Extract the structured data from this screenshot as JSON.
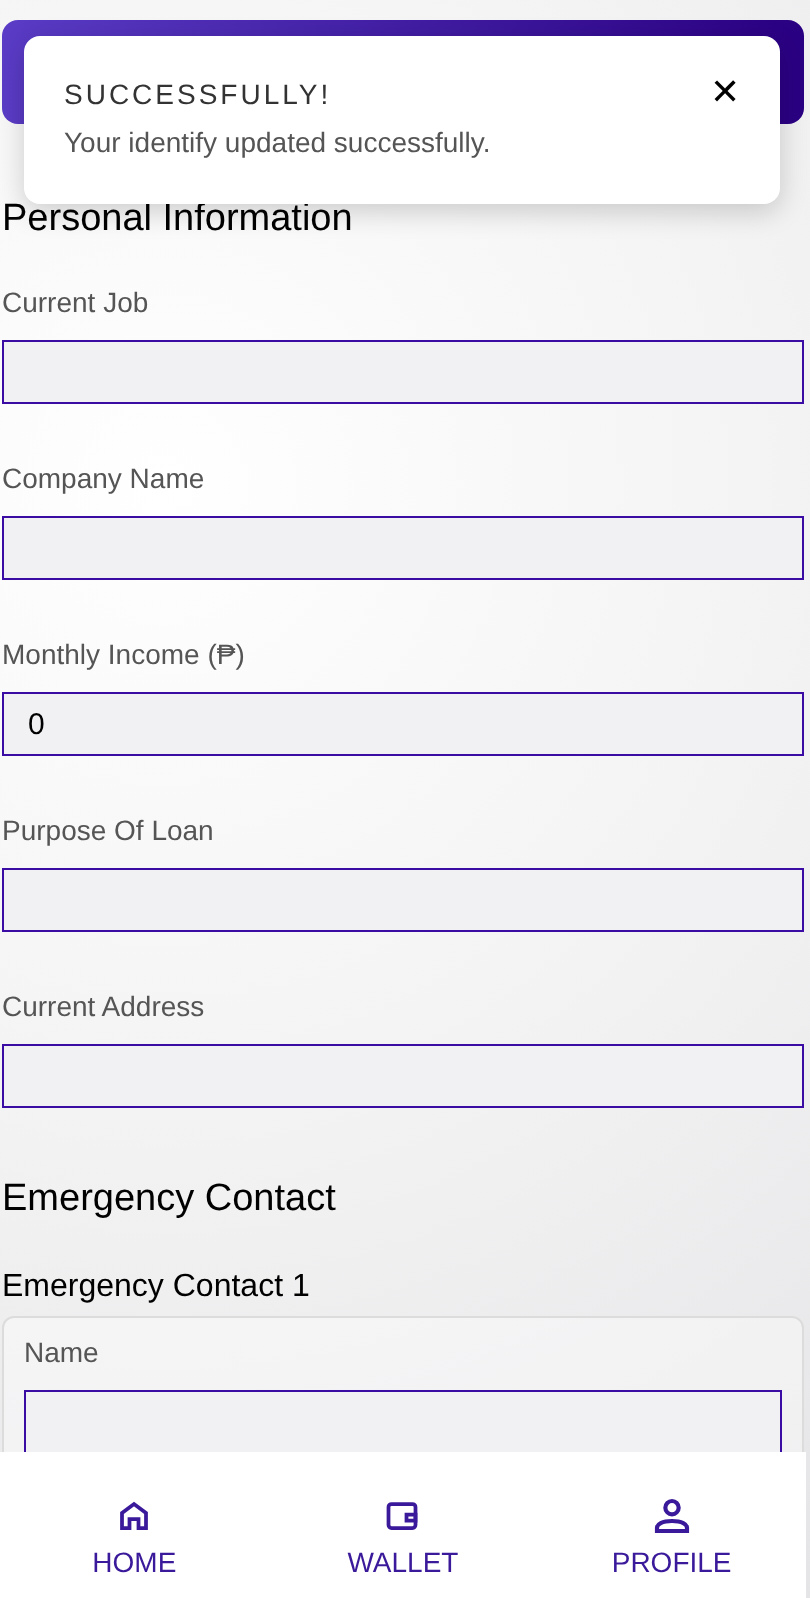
{
  "toast": {
    "title": "SUCCESSFULLY!",
    "message": "Your identify updated successfully.",
    "close": "✕"
  },
  "personal": {
    "heading": "Personal Information",
    "fields": [
      {
        "label": "Current Job"
      },
      {
        "label": "Company Name"
      },
      {
        "label": "Monthly Income (₱)",
        "value": "0"
      },
      {
        "label": "Purpose Of Loan"
      },
      {
        "label": "Current Address"
      }
    ]
  },
  "emergency": {
    "heading": "Emergency Contact",
    "contacts": [
      {
        "title": "Emergency Contact 1",
        "fields": [
          {
            "label": "Name"
          }
        ]
      }
    ]
  },
  "nav": [
    {
      "kind": "home",
      "label": "HOME"
    },
    {
      "kind": "wallet",
      "label": "WALLET"
    },
    {
      "kind": "profile",
      "label": "PROFILE"
    }
  ]
}
